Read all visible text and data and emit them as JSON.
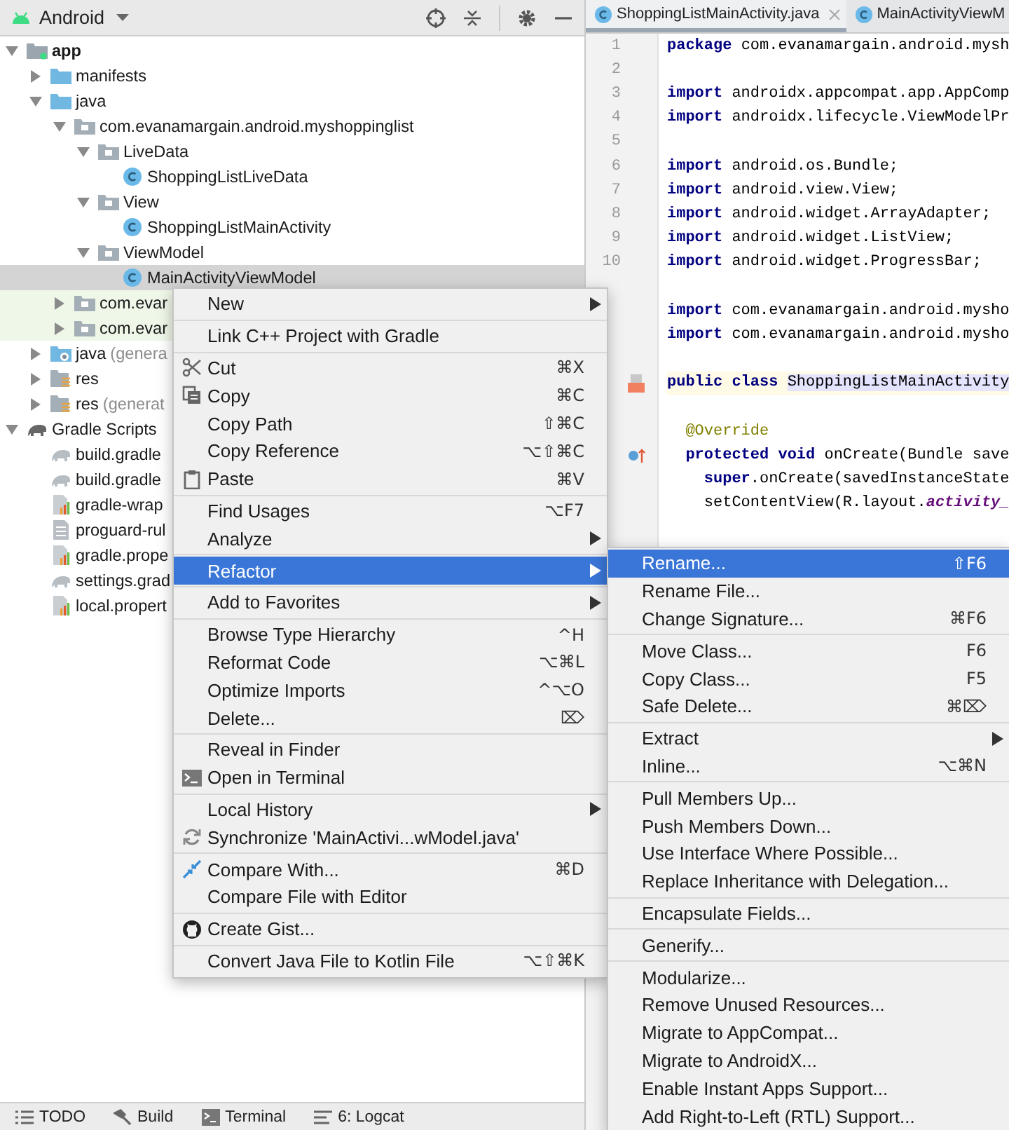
{
  "project_panel": {
    "view_selector": "Android"
  },
  "tree": [
    {
      "label": "app",
      "kind": "module",
      "expanded": true,
      "selected": false,
      "highlighted": false,
      "children": [
        {
          "label": "manifests",
          "kind": "folder",
          "expanded": false,
          "selected": false,
          "highlighted": false
        },
        {
          "label": "java",
          "kind": "folder",
          "expanded": true,
          "selected": false,
          "highlighted": false,
          "children": [
            {
              "label": "com.evanamargain.android.myshoppinglist",
              "kind": "package",
              "expanded": true,
              "selected": false,
              "highlighted": false,
              "children": [
                {
                  "label": "LiveData",
                  "kind": "package",
                  "expanded": true,
                  "selected": false,
                  "highlighted": false,
                  "children": [
                    {
                      "label": "ShoppingListLiveData",
                      "kind": "class",
                      "selected": false,
                      "highlighted": false
                    }
                  ]
                },
                {
                  "label": "View",
                  "kind": "package",
                  "expanded": true,
                  "selected": false,
                  "highlighted": false,
                  "children": [
                    {
                      "label": "ShoppingListMainActivity",
                      "kind": "class",
                      "selected": false,
                      "highlighted": false
                    }
                  ]
                },
                {
                  "label": "ViewModel",
                  "kind": "package",
                  "expanded": true,
                  "selected": false,
                  "highlighted": false,
                  "children": [
                    {
                      "label": "MainActivityViewModel",
                      "kind": "class",
                      "selected": true,
                      "highlighted": false
                    }
                  ]
                }
              ]
            },
            {
              "label": "com.evar",
              "kind": "package",
              "expanded": false,
              "selected": false,
              "highlighted": true
            },
            {
              "label": "com.evar",
              "kind": "package",
              "expanded": false,
              "selected": false,
              "highlighted": true
            }
          ]
        },
        {
          "label": "java",
          "note": "(genera",
          "kind": "generated-folder",
          "expanded": false,
          "selected": false,
          "highlighted": false
        },
        {
          "label": "res",
          "kind": "res-folder",
          "expanded": false,
          "selected": false,
          "highlighted": false
        },
        {
          "label": "res",
          "note": "(generat",
          "kind": "res-folder",
          "expanded": false,
          "selected": false,
          "highlighted": false
        }
      ]
    },
    {
      "label": "Gradle Scripts",
      "kind": "gradle",
      "expanded": true,
      "selected": false,
      "highlighted": false,
      "children": [
        {
          "label": "build.gradle",
          "kind": "gradle",
          "selected": false,
          "highlighted": false
        },
        {
          "label": "build.gradle",
          "kind": "gradle",
          "selected": false,
          "highlighted": false
        },
        {
          "label": "gradle-wrap",
          "kind": "properties",
          "selected": false,
          "highlighted": false
        },
        {
          "label": "proguard-rul",
          "kind": "file",
          "selected": false,
          "highlighted": false
        },
        {
          "label": "gradle.prope",
          "kind": "properties",
          "selected": false,
          "highlighted": false
        },
        {
          "label": "settings.grad",
          "kind": "gradle",
          "selected": false,
          "highlighted": false
        },
        {
          "label": "local.propert",
          "kind": "properties",
          "selected": false,
          "highlighted": false
        }
      ]
    }
  ],
  "tool_windows": [
    {
      "label": "TODO",
      "kind": "list"
    },
    {
      "label": "Build",
      "kind": "hammer"
    },
    {
      "label": "Terminal",
      "kind": "terminal"
    },
    {
      "label": "6: Logcat",
      "kind": "logcat"
    }
  ],
  "editor_tabs": [
    {
      "label": "ShoppingListMainActivity.java",
      "selected": true,
      "closable": true
    },
    {
      "label": "MainActivityViewM",
      "selected": false,
      "closable": false
    }
  ],
  "code_lines": [
    {
      "number": "1",
      "kind": "code",
      "tokens": [
        {
          "text": "package",
          "kind": "keyword"
        },
        {
          "text": " com.evanamargain.android.mysh",
          "kind": "plain"
        }
      ]
    },
    {
      "number": "2",
      "kind": "blank"
    },
    {
      "number": "3",
      "kind": "code",
      "tokens": [
        {
          "text": "import",
          "kind": "keyword"
        },
        {
          "text": " androidx.appcompat.app.AppComp",
          "kind": "plain"
        }
      ]
    },
    {
      "number": "4",
      "kind": "code",
      "tokens": [
        {
          "text": "import",
          "kind": "keyword"
        },
        {
          "text": " androidx.lifecycle.ViewModelPr",
          "kind": "plain"
        }
      ]
    },
    {
      "number": "5",
      "kind": "blank"
    },
    {
      "number": "6",
      "kind": "code",
      "tokens": [
        {
          "text": "import",
          "kind": "keyword"
        },
        {
          "text": " android.os.Bundle;",
          "kind": "plain"
        }
      ]
    },
    {
      "number": "7",
      "kind": "code",
      "tokens": [
        {
          "text": "import",
          "kind": "keyword"
        },
        {
          "text": " android.view.View;",
          "kind": "plain"
        }
      ]
    },
    {
      "number": "8",
      "kind": "code",
      "tokens": [
        {
          "text": "import",
          "kind": "keyword"
        },
        {
          "text": " android.widget.ArrayAdapter;",
          "kind": "plain"
        }
      ]
    },
    {
      "number": "9",
      "kind": "code",
      "tokens": [
        {
          "text": "import",
          "kind": "keyword"
        },
        {
          "text": " android.widget.ListView;",
          "kind": "plain"
        }
      ]
    },
    {
      "number": "10",
      "kind": "code",
      "tokens": [
        {
          "text": "import",
          "kind": "keyword"
        },
        {
          "text": " android.widget.ProgressBar;",
          "kind": "plain"
        }
      ]
    },
    {
      "kind": "blank"
    },
    {
      "kind": "code",
      "tokens": [
        {
          "text": "import",
          "kind": "keyword"
        },
        {
          "text": " com.evanamargain.android.mysho",
          "kind": "plain"
        }
      ]
    },
    {
      "kind": "code",
      "tokens": [
        {
          "text": "import",
          "kind": "keyword"
        },
        {
          "text": " com.evanamargain.android.mysho",
          "kind": "plain"
        }
      ]
    },
    {
      "kind": "blank"
    },
    {
      "kind": "class-declaration",
      "tokens": [
        {
          "text": "public class",
          "kind": "keyword"
        },
        {
          "text": "ShoppingListMainActivity",
          "kind": "highlight"
        }
      ]
    },
    {
      "kind": "blank"
    },
    {
      "kind": "code",
      "tokens": [
        {
          "text": "  @Override",
          "kind": "annotation"
        }
      ]
    },
    {
      "kind": "override-method",
      "tokens": [
        {
          "text": "  protected void",
          "kind": "keyword"
        },
        {
          "text": " onCreate(Bundle save",
          "kind": "plain"
        }
      ]
    },
    {
      "kind": "code",
      "tokens": [
        {
          "text": "    super",
          "kind": "keyword"
        },
        {
          "text": ".onCreate(savedInstanceState",
          "kind": "plain"
        }
      ]
    },
    {
      "kind": "code",
      "tokens": [
        {
          "text": "    setContentView(R.layout.",
          "kind": "plain"
        },
        {
          "text": "activity_",
          "kind": "field"
        }
      ]
    }
  ],
  "context_menu": {
    "groups": [
      [
        {
          "label": "New",
          "submenu": true,
          "selected": false
        }
      ],
      [
        {
          "label": "Link C++ Project with Gradle",
          "submenu": false,
          "selected": false
        }
      ],
      [
        {
          "label": "Cut",
          "shortcut": "⌘X",
          "kind": "cut",
          "submenu": false,
          "selected": false
        },
        {
          "label": "Copy",
          "shortcut": "⌘C",
          "kind": "copy",
          "submenu": false,
          "selected": false
        },
        {
          "label": "Copy Path",
          "shortcut": "⇧⌘C",
          "submenu": false,
          "selected": false
        },
        {
          "label": "Copy Reference",
          "shortcut": "⌥⇧⌘C",
          "submenu": false,
          "selected": false
        },
        {
          "label": "Paste",
          "shortcut": "⌘V",
          "kind": "paste",
          "submenu": false,
          "selected": false
        }
      ],
      [
        {
          "label": "Find Usages",
          "shortcut": "⌥F7",
          "submenu": false,
          "selected": false
        },
        {
          "label": "Analyze",
          "submenu": true,
          "selected": false
        }
      ],
      [
        {
          "label": "Refactor",
          "submenu": true,
          "selected": true
        }
      ],
      [
        {
          "label": "Add to Favorites",
          "submenu": true,
          "selected": false
        }
      ],
      [
        {
          "label": "Browse Type Hierarchy",
          "shortcut": "^H",
          "submenu": false,
          "selected": false
        },
        {
          "label": "Reformat Code",
          "shortcut": "⌥⌘L",
          "submenu": false,
          "selected": false
        },
        {
          "label": "Optimize Imports",
          "shortcut": "^⌥O",
          "submenu": false,
          "selected": false
        },
        {
          "label": "Delete...",
          "shortcut": "⌦",
          "submenu": false,
          "selected": false
        }
      ],
      [
        {
          "label": "Reveal in Finder",
          "submenu": false,
          "selected": false
        },
        {
          "label": "Open in Terminal",
          "kind": "terminal",
          "submenu": false,
          "selected": false
        }
      ],
      [
        {
          "label": "Local History",
          "submenu": true,
          "selected": false
        },
        {
          "label": "Synchronize 'MainActivi...wModel.java'",
          "kind": "sync",
          "submenu": false,
          "selected": false
        }
      ],
      [
        {
          "label": "Compare With...",
          "shortcut": "⌘D",
          "kind": "compare",
          "submenu": false,
          "selected": false
        },
        {
          "label": "Compare File with Editor",
          "submenu": false,
          "selected": false
        }
      ],
      [
        {
          "label": "Create Gist...",
          "kind": "gist",
          "submenu": false,
          "selected": false
        }
      ],
      [
        {
          "label": "Convert Java File to Kotlin File",
          "shortcut": "⌥⇧⌘K",
          "submenu": false,
          "selected": false
        }
      ]
    ]
  },
  "refactor_menu": {
    "groups": [
      [
        {
          "label": "Rename...",
          "shortcut": "⇧F6",
          "submenu": false,
          "selected": true
        },
        {
          "label": "Rename File...",
          "submenu": false,
          "selected": false
        },
        {
          "label": "Change Signature...",
          "shortcut": "⌘F6",
          "submenu": false,
          "selected": false
        }
      ],
      [
        {
          "label": "Move Class...",
          "shortcut": "F6",
          "submenu": false,
          "selected": false
        },
        {
          "label": "Copy Class...",
          "shortcut": "F5",
          "submenu": false,
          "selected": false
        },
        {
          "label": "Safe Delete...",
          "shortcut": "⌘⌦",
          "submenu": false,
          "selected": false
        }
      ],
      [
        {
          "label": "Extract",
          "submenu": true,
          "selected": false
        },
        {
          "label": "Inline...",
          "shortcut": "⌥⌘N",
          "submenu": false,
          "selected": false
        }
      ],
      [
        {
          "label": "Pull Members Up...",
          "submenu": false,
          "selected": false
        },
        {
          "label": "Push Members Down...",
          "submenu": false,
          "selected": false
        },
        {
          "label": "Use Interface Where Possible...",
          "submenu": false,
          "selected": false
        },
        {
          "label": "Replace Inheritance with Delegation...",
          "submenu": false,
          "selected": false
        }
      ],
      [
        {
          "label": "Encapsulate Fields...",
          "submenu": false,
          "selected": false
        }
      ],
      [
        {
          "label": "Generify...",
          "submenu": false,
          "selected": false
        }
      ],
      [
        {
          "label": "Modularize...",
          "submenu": false,
          "selected": false
        },
        {
          "label": "Remove Unused Resources...",
          "submenu": false,
          "selected": false
        },
        {
          "label": "Migrate to AppCompat...",
          "submenu": false,
          "selected": false
        },
        {
          "label": "Migrate to AndroidX...",
          "submenu": false,
          "selected": false
        },
        {
          "label": "Enable Instant Apps Support...",
          "submenu": false,
          "selected": false
        },
        {
          "label": "Add Right-to-Left (RTL) Support...",
          "submenu": false,
          "selected": false
        }
      ]
    ]
  }
}
